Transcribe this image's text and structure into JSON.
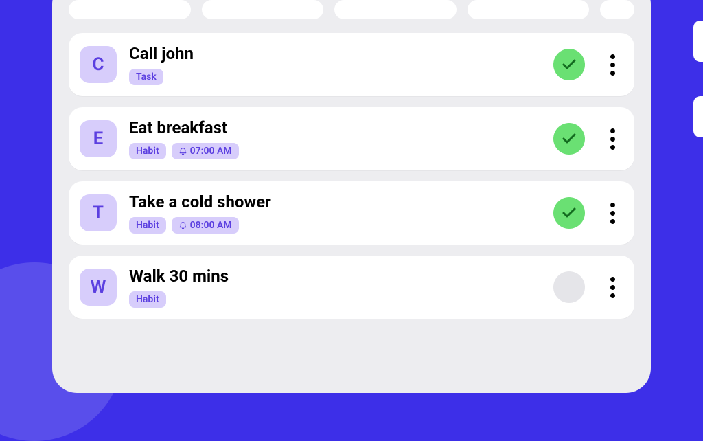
{
  "colors": {
    "accent": "#5B3FE0",
    "avatarBg": "#D7CDFB",
    "checkDone": "#6AE073",
    "checkStroke": "#136B1F"
  },
  "items": [
    {
      "letter": "C",
      "title": "Call john",
      "type": "Task",
      "time": null,
      "done": true
    },
    {
      "letter": "E",
      "title": "Eat breakfast",
      "type": "Habit",
      "time": "07:00 AM",
      "done": true
    },
    {
      "letter": "T",
      "title": "Take a cold shower",
      "type": "Habit",
      "time": "08:00 AM",
      "done": true
    },
    {
      "letter": "W",
      "title": "Walk 30 mins",
      "type": "Habit",
      "time": null,
      "done": false
    }
  ]
}
